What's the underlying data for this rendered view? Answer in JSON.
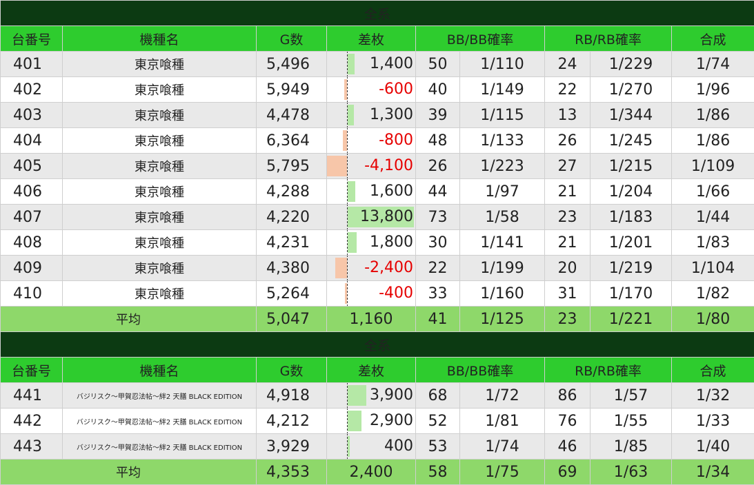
{
  "colors": {
    "title_bg": "#0c3a12",
    "header_bg": "#2ecc2e",
    "avg_bg": "#8ed86a",
    "pos_bar": "#b5e8a6",
    "neg_bar": "#f7c6a9",
    "neg_text": "#e60000"
  },
  "diff_scale_max": 13800,
  "tables": [
    {
      "title": "全系",
      "headers": {
        "num": "台番号",
        "model": "機種名",
        "g": "G数",
        "diff": "差枚",
        "bb": "BB/BB確率",
        "rb": "RB/RB確率",
        "total": "合成"
      },
      "rows": [
        {
          "num": "401",
          "model": "東京喰種",
          "g": "5,496",
          "diff": "1,400",
          "diff_value": 1400,
          "bb": "50",
          "bb_rate": "1/110",
          "rb": "24",
          "rb_rate": "1/229",
          "total": "1/74"
        },
        {
          "num": "402",
          "model": "東京喰種",
          "g": "5,949",
          "diff": "-600",
          "diff_value": -600,
          "bb": "40",
          "bb_rate": "1/149",
          "rb": "22",
          "rb_rate": "1/270",
          "total": "1/96"
        },
        {
          "num": "403",
          "model": "東京喰種",
          "g": "4,478",
          "diff": "1,300",
          "diff_value": 1300,
          "bb": "39",
          "bb_rate": "1/115",
          "rb": "13",
          "rb_rate": "1/344",
          "total": "1/86"
        },
        {
          "num": "404",
          "model": "東京喰種",
          "g": "6,364",
          "diff": "-800",
          "diff_value": -800,
          "bb": "48",
          "bb_rate": "1/133",
          "rb": "26",
          "rb_rate": "1/245",
          "total": "1/86"
        },
        {
          "num": "405",
          "model": "東京喰種",
          "g": "5,795",
          "diff": "-4,100",
          "diff_value": -4100,
          "bb": "26",
          "bb_rate": "1/223",
          "rb": "27",
          "rb_rate": "1/215",
          "total": "1/109"
        },
        {
          "num": "406",
          "model": "東京喰種",
          "g": "4,288",
          "diff": "1,600",
          "diff_value": 1600,
          "bb": "44",
          "bb_rate": "1/97",
          "rb": "21",
          "rb_rate": "1/204",
          "total": "1/66"
        },
        {
          "num": "407",
          "model": "東京喰種",
          "g": "4,220",
          "diff": "13,800",
          "diff_value": 13800,
          "bb": "73",
          "bb_rate": "1/58",
          "rb": "23",
          "rb_rate": "1/183",
          "total": "1/44"
        },
        {
          "num": "408",
          "model": "東京喰種",
          "g": "4,231",
          "diff": "1,800",
          "diff_value": 1800,
          "bb": "30",
          "bb_rate": "1/141",
          "rb": "21",
          "rb_rate": "1/201",
          "total": "1/83"
        },
        {
          "num": "409",
          "model": "東京喰種",
          "g": "4,380",
          "diff": "-2,400",
          "diff_value": -2400,
          "bb": "22",
          "bb_rate": "1/199",
          "rb": "20",
          "rb_rate": "1/219",
          "total": "1/104"
        },
        {
          "num": "410",
          "model": "東京喰種",
          "g": "5,264",
          "diff": "-400",
          "diff_value": -400,
          "bb": "33",
          "bb_rate": "1/160",
          "rb": "31",
          "rb_rate": "1/170",
          "total": "1/82"
        }
      ],
      "avg": {
        "label": "平均",
        "g": "5,047",
        "diff": "1,160",
        "bb": "41",
        "bb_rate": "1/125",
        "rb": "23",
        "rb_rate": "1/221",
        "total": "1/80"
      }
    },
    {
      "title": "全系",
      "headers": {
        "num": "台番号",
        "model": "機種名",
        "g": "G数",
        "diff": "差枚",
        "bb": "BB/BB確率",
        "rb": "RB/RB確率",
        "total": "合成"
      },
      "rows": [
        {
          "num": "441",
          "model": "バジリスク～甲賀忍法帖～絆2 天膳 BLACK EDITION",
          "g": "4,918",
          "diff": "3,900",
          "diff_value": 3900,
          "bb": "68",
          "bb_rate": "1/72",
          "rb": "86",
          "rb_rate": "1/57",
          "total": "1/32"
        },
        {
          "num": "442",
          "model": "バジリスク～甲賀忍法帖～絆2 天膳 BLACK EDITION",
          "g": "4,212",
          "diff": "2,900",
          "diff_value": 2900,
          "bb": "52",
          "bb_rate": "1/81",
          "rb": "76",
          "rb_rate": "1/55",
          "total": "1/33"
        },
        {
          "num": "443",
          "model": "バジリスク～甲賀忍法帖～絆2 天膳 BLACK EDITION",
          "g": "3,929",
          "diff": "400",
          "diff_value": 400,
          "bb": "53",
          "bb_rate": "1/74",
          "rb": "46",
          "rb_rate": "1/85",
          "total": "1/40"
        }
      ],
      "avg": {
        "label": "平均",
        "g": "4,353",
        "diff": "2,400",
        "bb": "58",
        "bb_rate": "1/75",
        "rb": "69",
        "rb_rate": "1/63",
        "total": "1/34"
      }
    }
  ]
}
